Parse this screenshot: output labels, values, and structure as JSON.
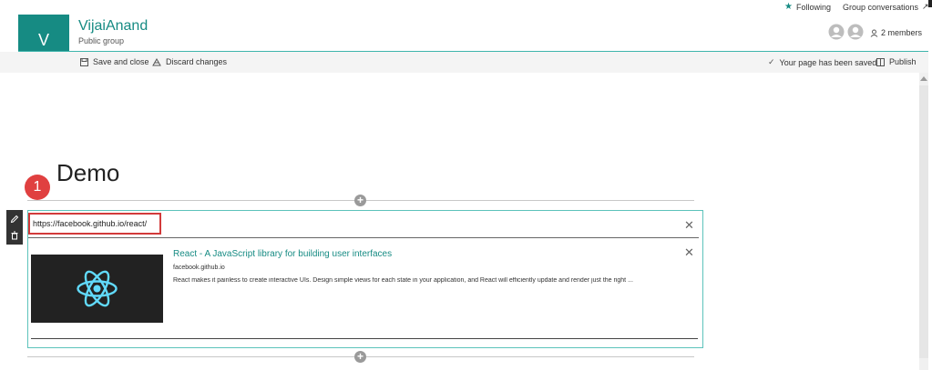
{
  "header": {
    "avatar_letter": "V",
    "site_title": "VijaiAnand",
    "site_subtitle": "Public group",
    "following_label": "Following",
    "group_conversations_label": "Group conversations",
    "members_label": "2 members"
  },
  "toolbar": {
    "save_close_label": "Save and close",
    "discard_label": "Discard changes",
    "saved_status": "Your page has been saved",
    "publish_label": "Publish"
  },
  "page": {
    "title": "Demo",
    "badge_number": "1"
  },
  "link_webpart": {
    "url_value": "https://facebook.github.io/react/",
    "preview_title": "React - A JavaScript library for building user interfaces",
    "preview_domain": "facebook.github.io",
    "preview_description": "React makes it painless to create interactive UIs. Design simple views for each state in your application, and React will efficiently update and render just the right ..."
  },
  "colors": {
    "accent": "#168b83",
    "badge": "#e04040",
    "react_logo": "#61dafb",
    "highlight_border": "#d23a3a"
  }
}
